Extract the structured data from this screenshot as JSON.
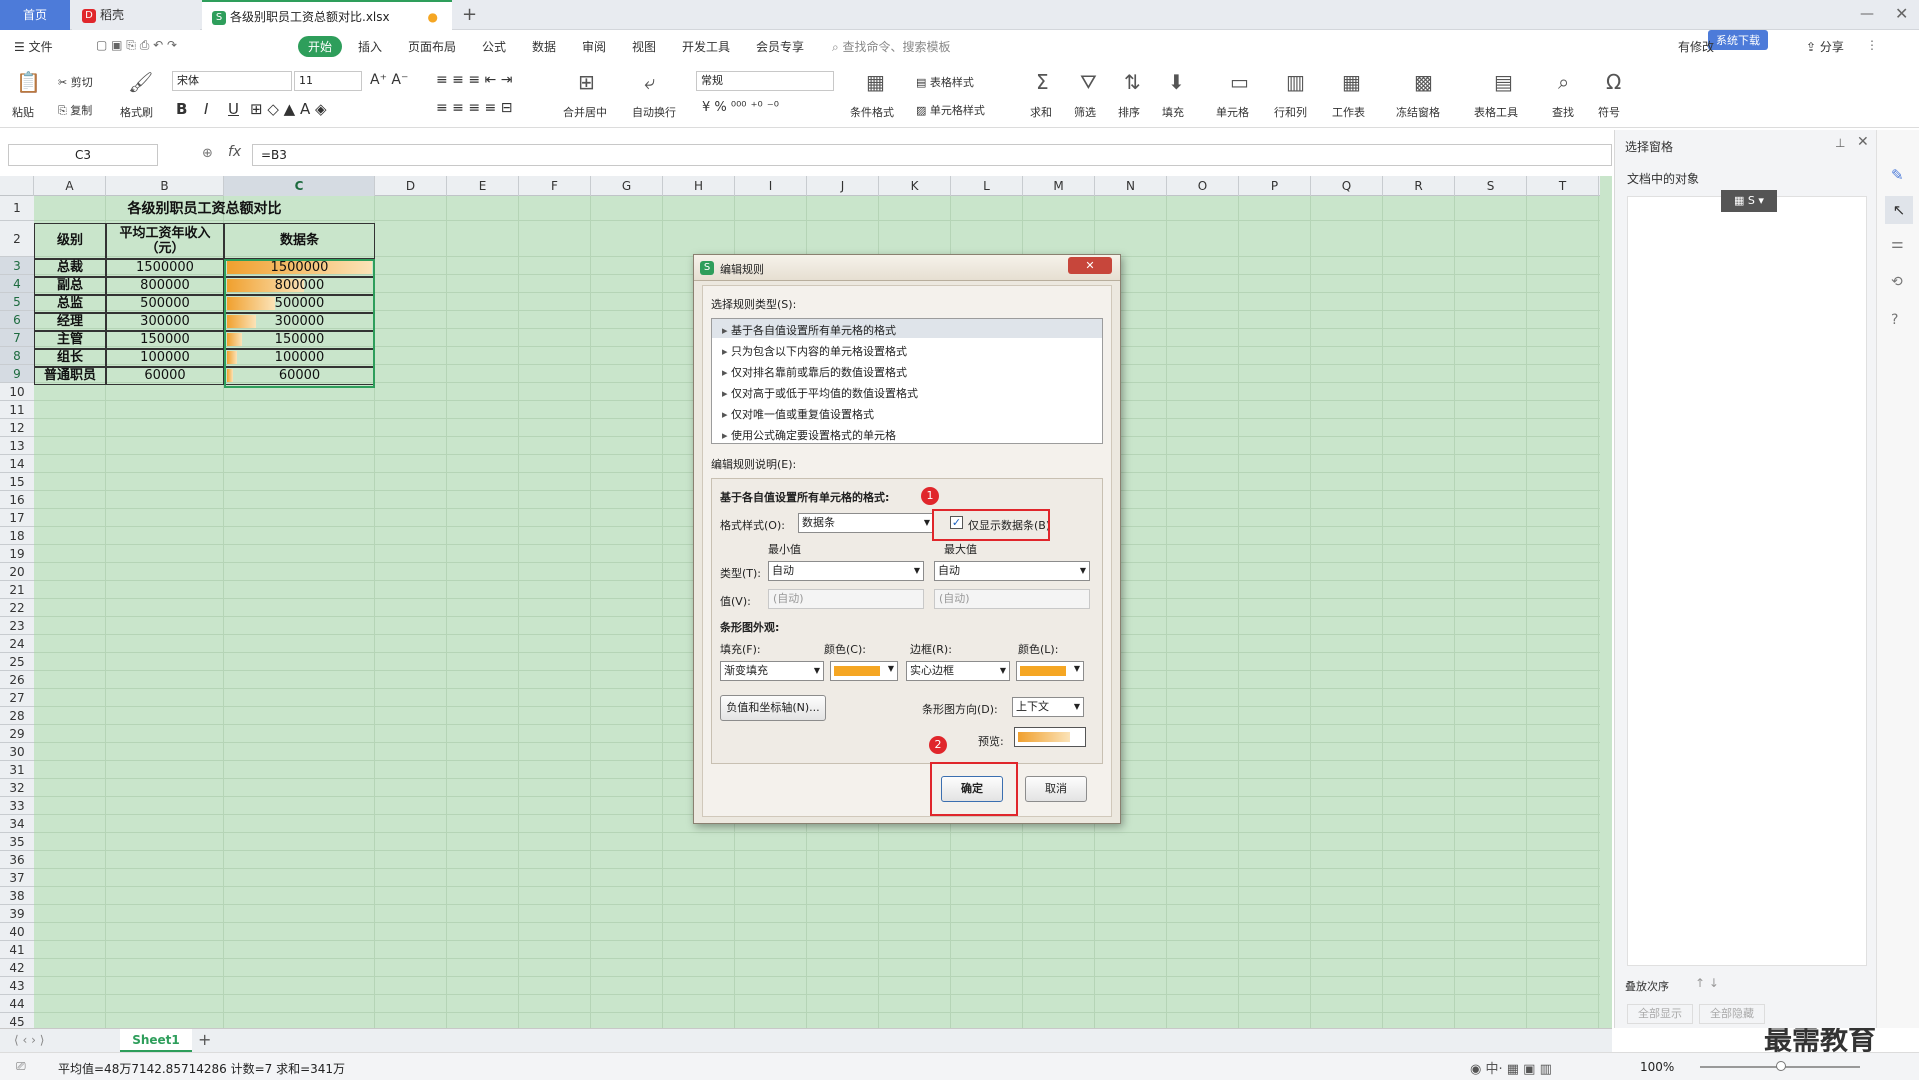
{
  "tabs": {
    "home": "首页",
    "doc": "稻壳",
    "file": "各级别职员工资总额对比.xlsx"
  },
  "menu": {
    "file": "文件",
    "items": [
      "开始",
      "插入",
      "页面布局",
      "公式",
      "数据",
      "审阅",
      "视图",
      "开发工具",
      "会员专享"
    ],
    "search": "查找命令、搜索模板",
    "right": [
      "有修改",
      "分享"
    ],
    "cloud_badge": "系统下载"
  },
  "ribbon": {
    "paste": "粘贴",
    "cut": "剪切",
    "copy": "复制",
    "format_painter": "格式刷",
    "font": "宋体",
    "size": "11",
    "merge": "合并居中",
    "wrap": "自动换行",
    "numfmt": "常规",
    "cond_format": "条件格式",
    "table_style": "表格样式",
    "cell_style": "单元格样式",
    "sum": "求和",
    "filter": "筛选",
    "sort": "排序",
    "fill": "填充",
    "cell": "单元格",
    "rowcol": "行和列",
    "worksheet": "工作表",
    "freeze": "冻结窗格",
    "table_tools": "表格工具",
    "find": "查找",
    "symbol": "符号"
  },
  "formula_bar": {
    "name": "C3",
    "fx": "fx",
    "value": "=B3"
  },
  "columns": [
    "A",
    "B",
    "C",
    "D",
    "E",
    "F",
    "G",
    "H",
    "I",
    "J",
    "K",
    "L",
    "M",
    "N",
    "O",
    "P",
    "Q",
    "R",
    "S",
    "T"
  ],
  "rows": [
    "1",
    "2",
    "3",
    "4",
    "5",
    "6",
    "7",
    "8",
    "9",
    "10",
    "11",
    "12",
    "13",
    "14",
    "15",
    "16",
    "17",
    "18",
    "19",
    "20",
    "21",
    "22",
    "23",
    "24",
    "25",
    "26",
    "27",
    "28",
    "29",
    "30",
    "31",
    "32",
    "33",
    "34",
    "35",
    "36",
    "37",
    "38",
    "39",
    "40",
    "41",
    "42",
    "43",
    "44",
    "45"
  ],
  "table": {
    "title": "各级别职员工资总额对比",
    "headers": [
      "级别",
      "平均工资年收入（元）",
      "数据条"
    ],
    "rows": [
      {
        "level": "总裁",
        "income": "1500000",
        "bar": "1500000",
        "ratio": 1.0
      },
      {
        "level": "副总",
        "income": "800000",
        "bar": "800000",
        "ratio": 0.533
      },
      {
        "level": "总监",
        "income": "500000",
        "bar": "500000",
        "ratio": 0.333
      },
      {
        "level": "经理",
        "income": "300000",
        "bar": "300000",
        "ratio": 0.2
      },
      {
        "level": "主管",
        "income": "150000",
        "bar": "150000",
        "ratio": 0.1
      },
      {
        "level": "组长",
        "income": "100000",
        "bar": "100000",
        "ratio": 0.067
      },
      {
        "level": "普通职员",
        "income": "60000",
        "bar": "60000",
        "ratio": 0.04
      }
    ]
  },
  "dialog": {
    "title": "编辑规则",
    "select_type": "选择规则类型(S):",
    "types": [
      "基于各自值设置所有单元格的格式",
      "只为包含以下内容的单元格设置格式",
      "仅对排名靠前或靠后的数值设置格式",
      "仅对高于或低于平均值的数值设置格式",
      "仅对唯一值或重复值设置格式",
      "使用公式确定要设置格式的单元格"
    ],
    "desc_label": "编辑规则说明(E):",
    "desc_title": "基于各自值设置所有单元格的格式:",
    "format_style": "格式样式(O):",
    "format_value": "数据条",
    "only_bar": "仅显示数据条(B)",
    "min": "最小值",
    "max": "最大值",
    "type_label": "类型(T):",
    "min_type": "自动",
    "max_type": "自动",
    "value_label": "值(V):",
    "min_value": "(自动)",
    "max_value": "(自动)",
    "bar_appearance": "条形图外观:",
    "fill_label": "填充(F):",
    "color_label": "颜色(C):",
    "border_label": "边框(R):",
    "color2_label": "颜色(L):",
    "fill_value": "渐变填充",
    "border_value": "实心边框",
    "neg_axis": "负值和坐标轴(N)...",
    "direction_label": "条形图方向(D):",
    "direction_value": "上下文",
    "preview_label": "预览:",
    "ok": "确定",
    "cancel": "取消",
    "marker1": "1",
    "marker2": "2",
    "accent": "#e0262b",
    "bar_color": "#f5a623"
  },
  "right_panel": {
    "title": "选择窗格",
    "objects": "文档中的对象",
    "order": "叠放次序",
    "show_all": "全部显示",
    "hide_all": "全部隐藏"
  },
  "sheet_tab": "Sheet1",
  "status": {
    "text": "平均值=48万7142.85714286  计数=7  求和=341万",
    "zoom": "100%",
    "brand": "最需教育"
  }
}
